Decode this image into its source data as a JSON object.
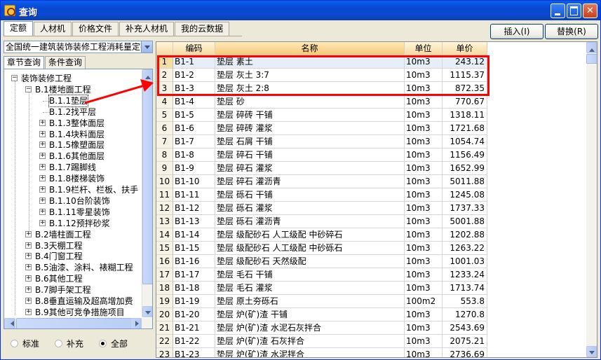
{
  "window": {
    "title": "查询"
  },
  "tabs": [
    "定额",
    "人材机",
    "价格文件",
    "补充人材机",
    "我的云数据"
  ],
  "buttons": {
    "insert": "插入(I)",
    "replace": "替换(R)"
  },
  "combo_value": "全国统一建筑装饰装修工程消耗量定额",
  "subtabs": [
    "章节查询",
    "条件查询"
  ],
  "tree": [
    "装饰装修工程",
    "B.1楼地面工程",
    "B.1.1垫层",
    "B.1.2找平层",
    "B.1.3整体面层",
    "B.1.4块料面层",
    "B.1.5橡塑面层",
    "B.1.6其他面层",
    "B.1.7踢脚线",
    "B.1.8楼梯装饰",
    "B.1.9栏杆、栏板、扶手",
    "B.1.10台阶装饰",
    "B.1.11零星装饰",
    "B.1.12预拌砂浆",
    "B.2墙柱面工程",
    "B.3天棚工程",
    "B.4门窗工程",
    "B.5油漆、涂料、裱糊工程",
    "B.6其他工程",
    "B.7脚手架工程",
    "B.8垂直运输及超高增加费",
    "B.9其他可竞争措施项目"
  ],
  "radios": [
    "标准",
    "补充",
    "全部"
  ],
  "grid": {
    "headers": [
      "编码",
      "名称",
      "单位",
      "单价"
    ],
    "rows": [
      [
        "1",
        "B1-1",
        "垫层 素土",
        "10m3",
        "243.12"
      ],
      [
        "2",
        "B1-2",
        "垫层 灰土 3:7",
        "10m3",
        "1115.37"
      ],
      [
        "3",
        "B1-3",
        "垫层 灰土 2:8",
        "10m3",
        "872.35"
      ],
      [
        "4",
        "B1-4",
        "垫层 砂",
        "10m3",
        "770.67"
      ],
      [
        "5",
        "B1-5",
        "垫层 碎砖 干铺",
        "10m3",
        "1318.11"
      ],
      [
        "6",
        "B1-6",
        "垫层 碎砖 灌浆",
        "10m3",
        "1721.68"
      ],
      [
        "7",
        "B1-7",
        "垫层 石屑 干铺",
        "10m3",
        "1054.74"
      ],
      [
        "8",
        "B1-8",
        "垫层 碎石 干铺",
        "10m3",
        "1156.49"
      ],
      [
        "9",
        "B1-9",
        "垫层 碎石 灌浆",
        "10m3",
        "1652.99"
      ],
      [
        "10",
        "B1-10",
        "垫层 碎石 灌沥青",
        "10m3",
        "5011.88"
      ],
      [
        "11",
        "B1-11",
        "垫层 砾石 干铺",
        "10m3",
        "1245.08"
      ],
      [
        "12",
        "B1-12",
        "垫层 砾石 灌浆",
        "10m3",
        "1737.33"
      ],
      [
        "13",
        "B1-13",
        "垫层 砾石 灌沥青",
        "10m3",
        "5001.88"
      ],
      [
        "14",
        "B1-14",
        "垫层 级配砂石 人工级配 中砂碎石",
        "10m3",
        "1202.88"
      ],
      [
        "15",
        "B1-15",
        "垫层 级配砂石 人工级配 中砂砾石",
        "10m3",
        "1263.22"
      ],
      [
        "16",
        "B1-16",
        "垫层 级配砂石 天然级配",
        "10m3",
        "1001.03"
      ],
      [
        "17",
        "B1-17",
        "垫层 毛石 干铺",
        "10m3",
        "1233.24"
      ],
      [
        "18",
        "B1-18",
        "垫层 毛石 灌浆",
        "10m3",
        "1713.74"
      ],
      [
        "19",
        "B1-19",
        "垫层 原土夯砾石",
        "100m2",
        "553.8"
      ],
      [
        "20",
        "B1-20",
        "垫层 炉(矿)渣 干铺",
        "10m3",
        "1270.8"
      ],
      [
        "21",
        "B1-21",
        "垫层 炉(矿)渣 水泥石灰拌合",
        "10m3",
        "2543.69"
      ],
      [
        "22",
        "B1-22",
        "垫层 炉(矿)渣 石灰拌合",
        "10m3",
        "2075.21"
      ],
      [
        "23",
        "B1-23",
        "垫层 炉(矿)渣 水泥拌合",
        "10m3",
        "2736.69"
      ]
    ]
  }
}
